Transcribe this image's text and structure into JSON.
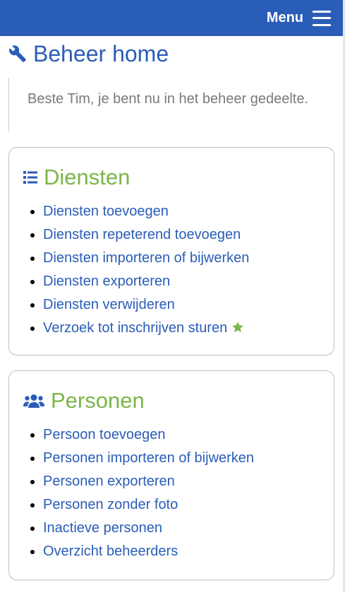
{
  "header": {
    "menu_label": "Menu",
    "bg_color": "#2a5db8"
  },
  "page": {
    "title": "Beheer home",
    "intro": "Beste Tim, je bent nu in het beheer gedeelte."
  },
  "diensten": {
    "heading": "Diensten",
    "items": [
      {
        "label": "Diensten toevoegen"
      },
      {
        "label": "Diensten repeterend toevoegen"
      },
      {
        "label": "Diensten importeren of bijwerken"
      },
      {
        "label": "Diensten exporteren"
      },
      {
        "label": "Diensten verwijderen"
      },
      {
        "label": "Verzoek tot inschrijven sturen",
        "icon": "star-icon"
      }
    ]
  },
  "personen": {
    "heading": "Personen",
    "items": [
      {
        "label": "Persoon toevoegen"
      },
      {
        "label": "Personen importeren of bijwerken"
      },
      {
        "label": "Personen exporteren"
      },
      {
        "label": "Personen zonder foto"
      },
      {
        "label": "Inactieve personen"
      },
      {
        "label": "Overzicht beheerders"
      }
    ]
  },
  "colors": {
    "link": "#2a5db8",
    "heading_green": "#7ab648",
    "muted": "#7a7a7a"
  }
}
